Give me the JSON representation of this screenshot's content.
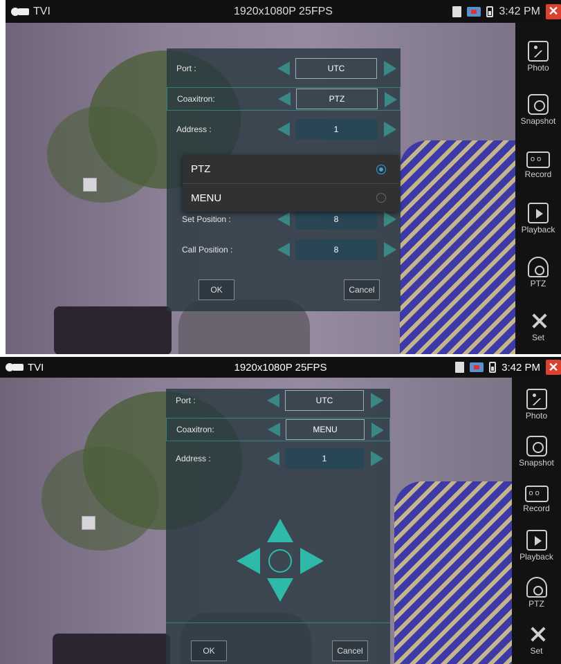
{
  "statusbar": {
    "mode": "TVI",
    "resolution": "1920x1080P 25FPS",
    "time": "3:42 PM"
  },
  "sidebar": {
    "items": [
      {
        "label": "Photo",
        "icon": "photo-icon"
      },
      {
        "label": "Snapshot",
        "icon": "camera-icon"
      },
      {
        "label": "Record",
        "icon": "record-icon"
      },
      {
        "label": "Playback",
        "icon": "play-icon"
      },
      {
        "label": "PTZ",
        "icon": "ptz-camera-icon"
      },
      {
        "label": "Set",
        "icon": "tools-icon"
      }
    ]
  },
  "screen1": {
    "rows": [
      {
        "label": "Port :",
        "value": "UTC"
      },
      {
        "label": "Coaxitron:",
        "value": "PTZ"
      },
      {
        "label": "Address :",
        "value": "1"
      },
      {
        "label": "Set Position :",
        "value": "8"
      },
      {
        "label": "Call Position :",
        "value": "8"
      }
    ],
    "ok": "OK",
    "cancel": "Cancel",
    "popup": {
      "options": [
        "PTZ",
        "MENU"
      ],
      "selected": "PTZ"
    }
  },
  "screen2": {
    "rows": [
      {
        "label": "Port :",
        "value": "UTC"
      },
      {
        "label": "Coaxitron:",
        "value": "MENU"
      },
      {
        "label": "Address :",
        "value": "1"
      }
    ],
    "ok": "OK",
    "cancel": "Cancel"
  },
  "colors": {
    "accent": "#2fb9a8",
    "close": "#d9422e",
    "radio_on": "#3aa0e0"
  }
}
